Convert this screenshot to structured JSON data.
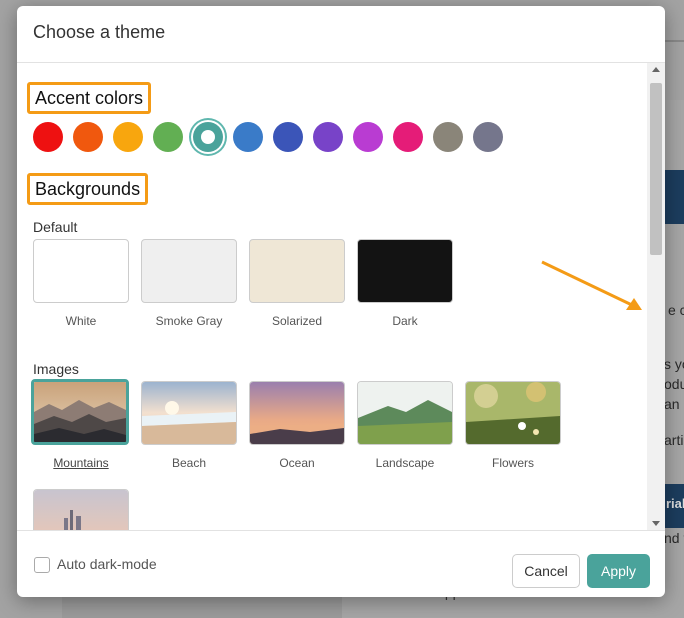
{
  "background": {
    "fragments": [
      "e co",
      "s yo",
      "oduc",
      "an",
      "arti",
      "rial",
      "nd t"
    ],
    "footer_text": "Your OX App Suite Team"
  },
  "modal": {
    "title": "Choose a theme",
    "accent_colors": {
      "title": "Accent colors",
      "colors": [
        "#ee1111",
        "#f0580e",
        "#f8a60e",
        "#62af53",
        "#4aa39b",
        "#3a7bc8",
        "#3b55b8",
        "#7843c8",
        "#b93cd2",
        "#e51c78",
        "#8a8579",
        "#75768c"
      ],
      "selected_index": 4
    },
    "backgrounds": {
      "title": "Backgrounds",
      "default": {
        "label": "Default",
        "items": [
          {
            "label": "White",
            "color": "#ffffff"
          },
          {
            "label": "Smoke Gray",
            "color": "#efefef"
          },
          {
            "label": "Solarized",
            "color": "#efe7d6"
          },
          {
            "label": "Dark",
            "color": "#131313"
          }
        ]
      },
      "images": {
        "label": "Images",
        "items": [
          {
            "label": "Mountains",
            "selected": true
          },
          {
            "label": "Beach"
          },
          {
            "label": "Ocean"
          },
          {
            "label": "Landscape"
          },
          {
            "label": "Flowers"
          },
          {
            "label": ""
          }
        ]
      }
    },
    "footer": {
      "auto_dark_label": "Auto dark-mode",
      "cancel_label": "Cancel",
      "apply_label": "Apply"
    }
  },
  "colors": {
    "accent": "#4aa39b",
    "highlight_border": "#f49b16"
  }
}
